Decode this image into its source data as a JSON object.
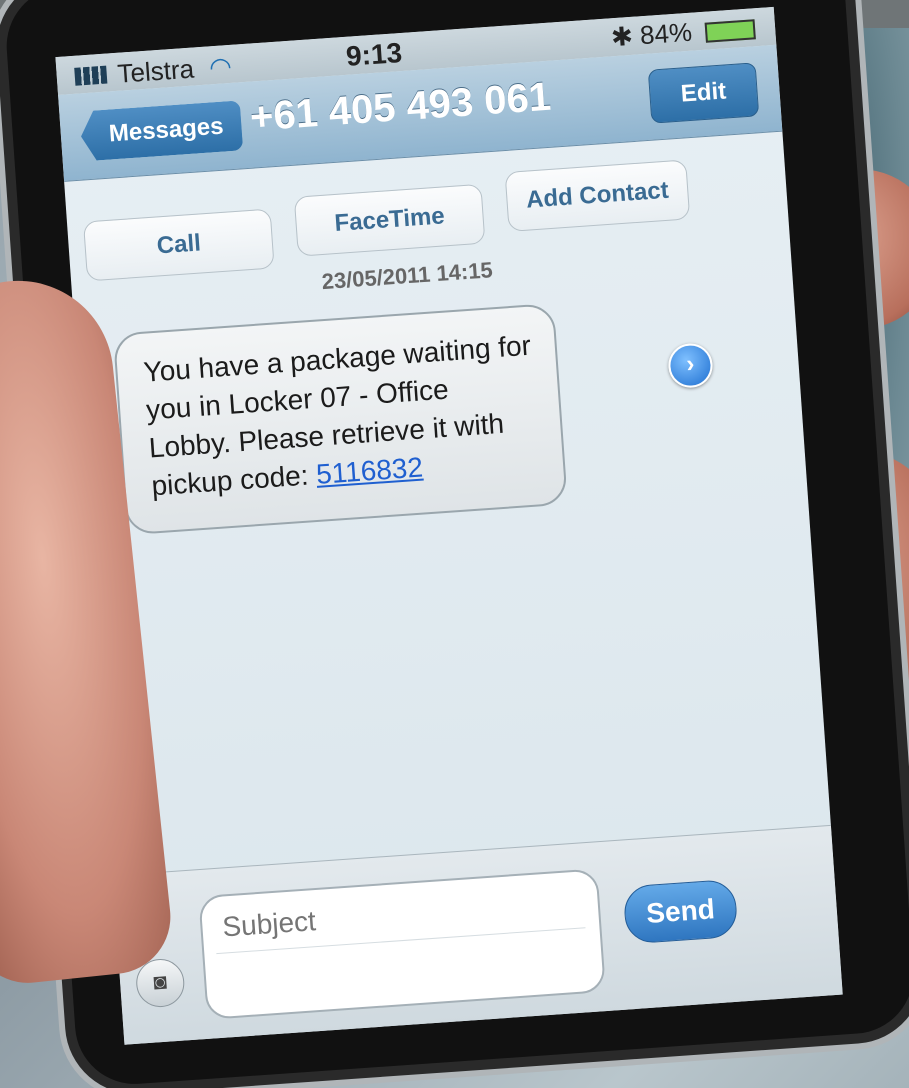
{
  "status_bar": {
    "carrier": "Telstra",
    "time": "9:13",
    "battery": "84%"
  },
  "nav": {
    "back_label": "Messages",
    "title": "+61 405 493 061",
    "edit_label": "Edit"
  },
  "actions": {
    "call": "Call",
    "facetime": "FaceTime",
    "add_contact": "Add Contact"
  },
  "conversation": {
    "timestamp": "23/05/2011 14:15",
    "message_text": "You have a package waiting for you in Locker 07 - Office Lobby. Please retrieve it with pickup code: ",
    "message_link": "5116832"
  },
  "composer": {
    "subject_placeholder": "Subject",
    "send_label": "Send"
  },
  "colors": {
    "nav_blue": "#2d6fa7",
    "link_blue": "#1f5fd0",
    "battery_green": "#7fd257"
  },
  "icons": [
    "signal-bars-icon",
    "wifi-icon",
    "bluetooth-icon",
    "battery-icon",
    "chevron-right-icon",
    "camera-icon"
  ]
}
